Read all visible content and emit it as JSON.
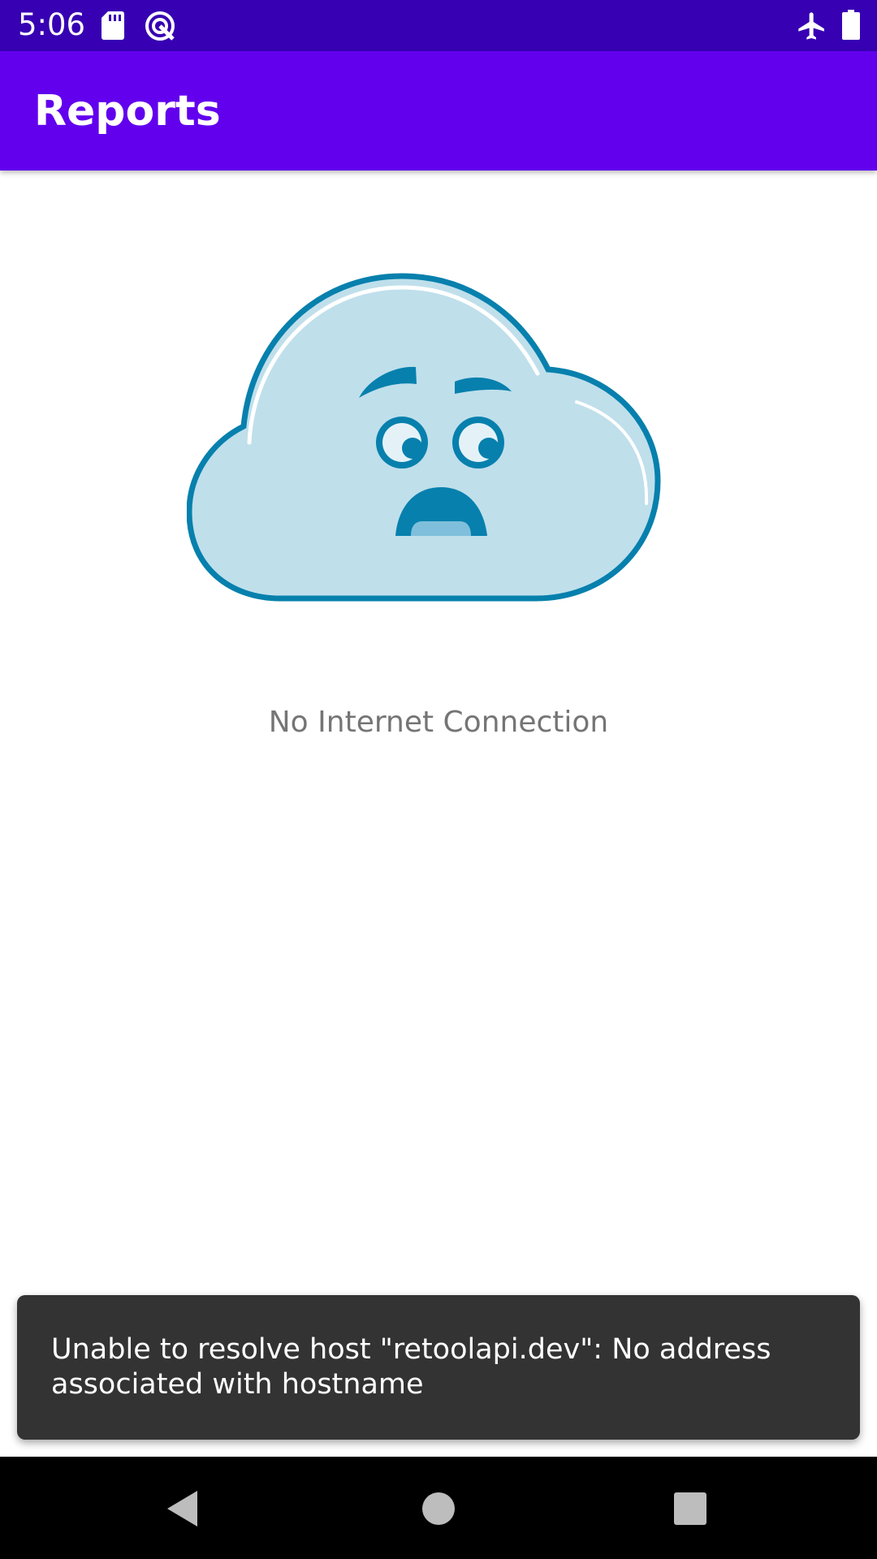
{
  "status_bar": {
    "time": "5:06",
    "icons": [
      "sd-card-icon",
      "sync-icon",
      "airplane-mode-icon",
      "battery-icon"
    ],
    "background": "#3700b3"
  },
  "app_bar": {
    "title": "Reports",
    "background": "#6200ee"
  },
  "empty_state": {
    "illustration": "sad-cloud-icon",
    "message": "No Internet Connection"
  },
  "snackbar": {
    "message": "Unable to resolve host \"retoolapi.dev\": No address associated with hostname",
    "background": "#333333"
  },
  "nav_bar": {
    "buttons": [
      "back-icon",
      "home-icon",
      "recents-icon"
    ]
  }
}
